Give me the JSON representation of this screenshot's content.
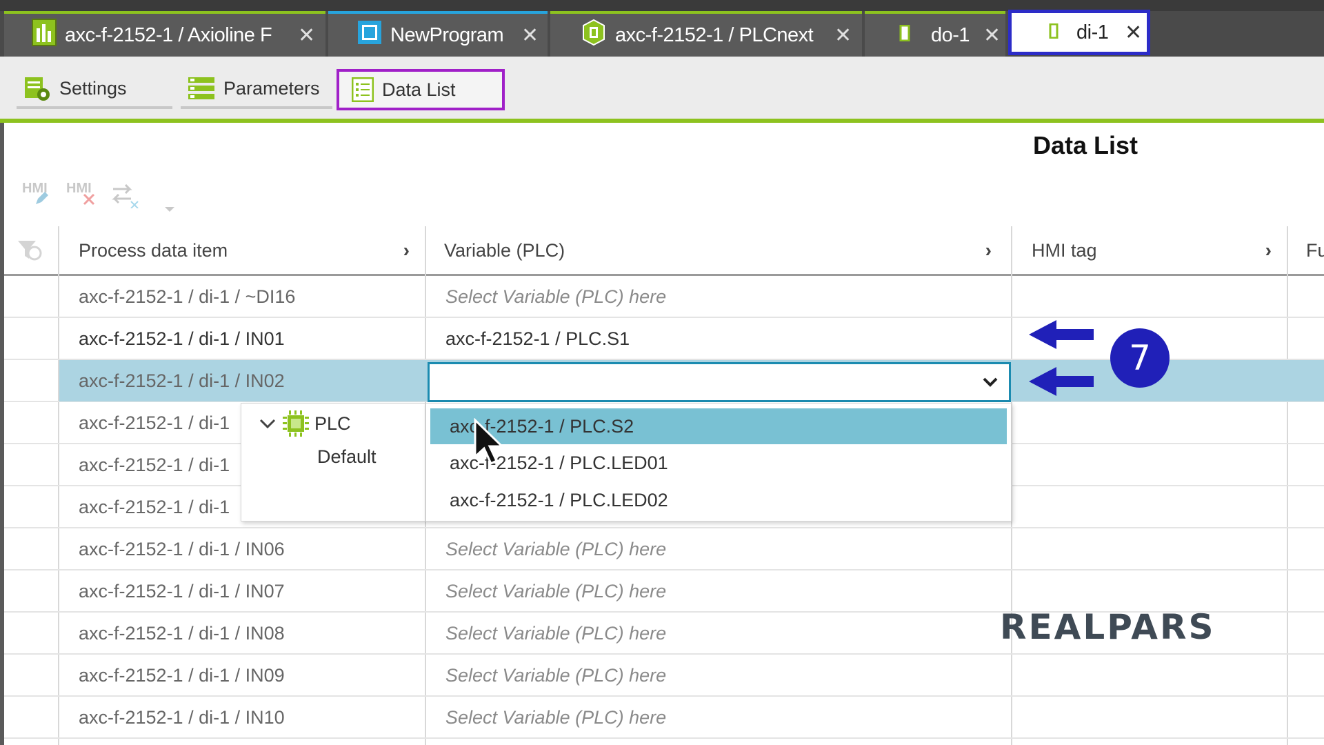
{
  "tabs": [
    {
      "label": "axc-f-2152-1 / Axioline F",
      "icon": "bar-chart-icon"
    },
    {
      "label": "NewProgram",
      "icon": "program-icon"
    },
    {
      "label": "axc-f-2152-1 / PLCnext",
      "icon": "plcnext-icon"
    },
    {
      "label": "do-1",
      "icon": "module-icon"
    },
    {
      "label": "di-1",
      "icon": "module-icon",
      "active": true
    }
  ],
  "close_glyph": "✕",
  "subtabs": {
    "settings": "Settings",
    "parameters": "Parameters",
    "data_list": "Data List"
  },
  "page_title": "Data List",
  "toolbar": {
    "hmi_edit": "HMI",
    "hmi_delete": "HMI"
  },
  "columns": {
    "process": "Process data item",
    "variable": "Variable (PLC)",
    "hmi": "HMI tag",
    "fu": "Fu"
  },
  "rows": [
    {
      "item": "axc-f-2152-1 / di-1 / ~DI16",
      "variable": "Select Variable (PLC) here"
    },
    {
      "item": "axc-f-2152-1 / di-1 / IN01",
      "variable": "axc-f-2152-1 / PLC.S1"
    },
    {
      "item": "axc-f-2152-1 / di-1 / IN02",
      "variable": ""
    },
    {
      "item": "axc-f-2152-1 / di-1",
      "variable": ""
    },
    {
      "item": "axc-f-2152-1 / di-1",
      "variable": ""
    },
    {
      "item": "axc-f-2152-1 / di-1",
      "variable": ""
    },
    {
      "item": "axc-f-2152-1 / di-1 / IN06",
      "variable": "Select Variable (PLC) here"
    },
    {
      "item": "axc-f-2152-1 / di-1 / IN07",
      "variable": "Select Variable (PLC) here"
    },
    {
      "item": "axc-f-2152-1 / di-1 / IN08",
      "variable": "Select Variable (PLC) here"
    },
    {
      "item": "axc-f-2152-1 / di-1 / IN09",
      "variable": "Select Variable (PLC) here"
    },
    {
      "item": "axc-f-2152-1 / di-1 / IN10",
      "variable": "Select Variable (PLC) here"
    }
  ],
  "dropdown": {
    "tree_root": "PLC",
    "tree_child": "Default",
    "options": [
      "axc-f-2152-1 / PLC.S2",
      "axc-f-2152-1 / PLC.LED01",
      "axc-f-2152-1 / PLC.LED02"
    ]
  },
  "step_badge": "7",
  "watermark": "REALPARS",
  "colors": {
    "accent_green": "#8dc21f",
    "highlight_box": "#2c2cc8",
    "subtab_highlight": "#a020c8",
    "selected_row": "#acd4e2",
    "selected_option": "#79c1d3"
  }
}
